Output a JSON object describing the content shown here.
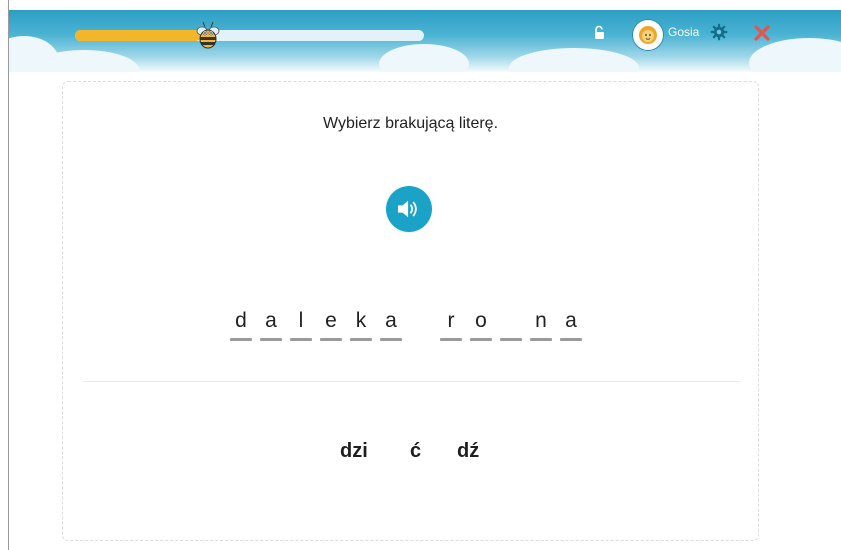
{
  "header": {
    "progress_percent": 36,
    "username": "Gosia",
    "accent_color": "#f1b62a",
    "bar_color": "#3aa9cd",
    "icons": [
      "bee-icon",
      "lock-open-icon",
      "lion-avatar-icon",
      "gear-icon",
      "close-icon"
    ]
  },
  "exercise": {
    "instruction": "Wybierz brakującą literę.",
    "audio_icon": "speaker-icon",
    "word_letters": [
      "d",
      "a",
      "l",
      "e",
      "k",
      "a",
      "r",
      "o",
      "",
      "n",
      "a"
    ],
    "options": [
      "dzi",
      "ć",
      "dź"
    ]
  },
  "colors": {
    "audio_button": "#1ba3c7",
    "close": "#e8534e",
    "gear": "#0f6f8f"
  }
}
